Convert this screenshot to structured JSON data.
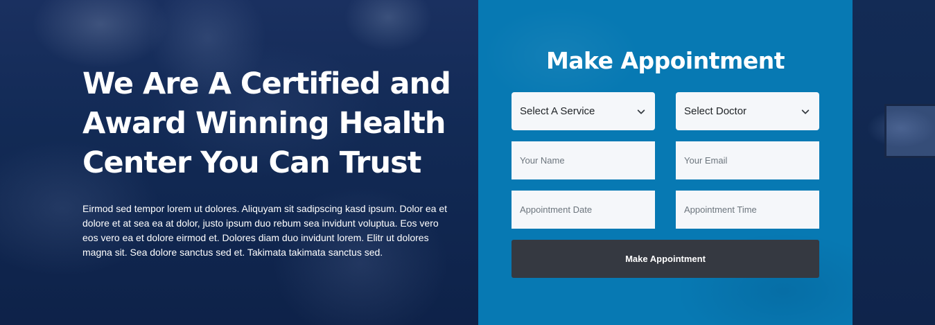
{
  "hero": {
    "headline": "We Are A Certified and Award Winning Health Center You Can Trust",
    "description": "Eirmod sed tempor lorem ut dolores. Aliquyam sit sadipscing kasd ipsum. Dolor ea et dolore et at sea ea at dolor, justo ipsum duo rebum sea invidunt voluptua. Eos vero eos vero ea et dolore eirmod et. Dolores diam duo invidunt lorem. Elitr ut dolores magna sit. Sea dolore sanctus sed et. Takimata takimata sanctus sed."
  },
  "appointment": {
    "title": "Make Appointment",
    "service_select": "Select A Service",
    "doctor_select": "Select Doctor",
    "name_placeholder": "Your Name",
    "email_placeholder": "Your Email",
    "date_placeholder": "Appointment Date",
    "time_placeholder": "Appointment Time",
    "submit_label": "Make Appointment"
  },
  "icons": {
    "select_arrow": "chevron-down-icon"
  },
  "colors": {
    "panel_background": "#0779b3",
    "page_background": "#0d2247",
    "button_background": "#353941",
    "field_background": "#f5f7fa"
  }
}
